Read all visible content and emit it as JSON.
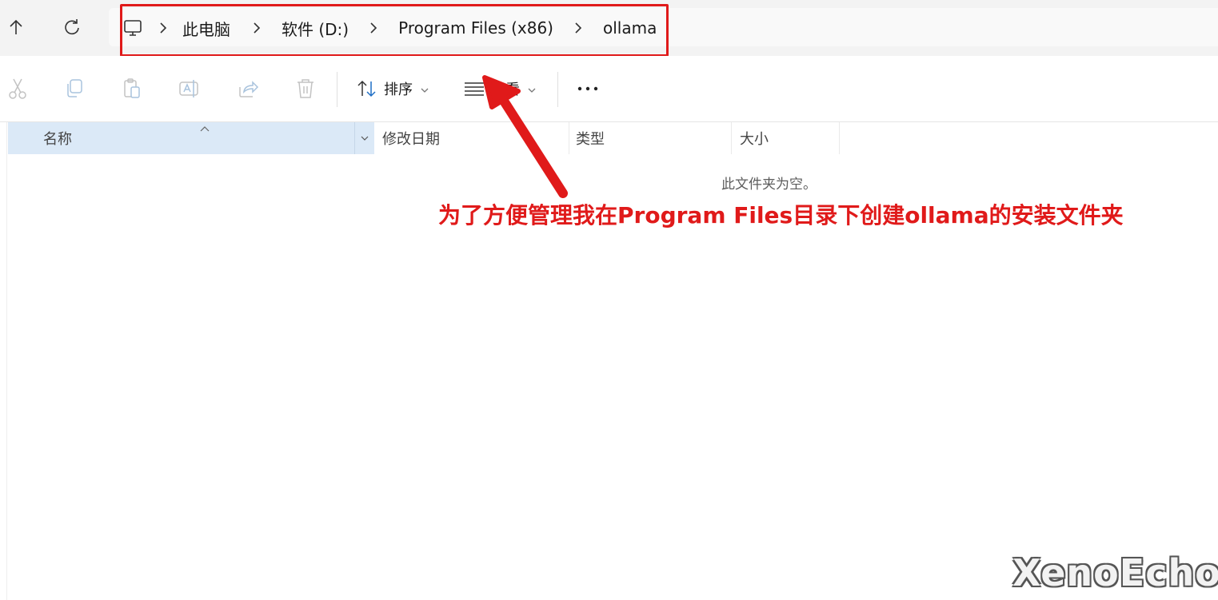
{
  "breadcrumb": {
    "items": [
      {
        "label": "此电脑"
      },
      {
        "label": "软件 (D:)"
      },
      {
        "label": "Program Files (x86)"
      },
      {
        "label": "ollama"
      }
    ]
  },
  "toolbar": {
    "sort_label": "排序",
    "view_label": "查看"
  },
  "columns": {
    "name": "名称",
    "date": "修改日期",
    "type": "类型",
    "size": "大小"
  },
  "content": {
    "empty_message": "此文件夹为空。"
  },
  "annotation": {
    "text": "为了方便管理我在Program Files目录下创建ollama的安装文件夹",
    "color": "#e01a1a"
  },
  "watermark": "XenoEcho",
  "icons": {
    "up": "arrow-up-icon",
    "refresh": "refresh-icon",
    "computer": "computer-icon",
    "cut": "cut-icon",
    "copy": "copy-icon",
    "paste": "paste-icon",
    "rename": "rename-icon",
    "share": "share-icon",
    "delete": "trash-icon",
    "sort": "sort-icon",
    "view": "view-list-icon",
    "more": "more-icon"
  }
}
